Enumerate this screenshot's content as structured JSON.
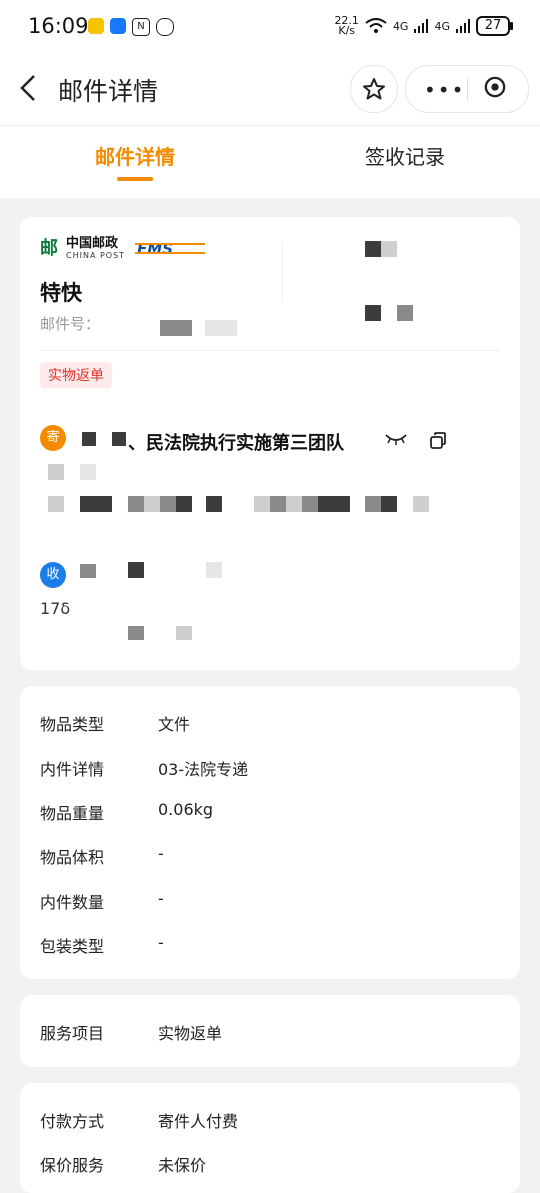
{
  "status_bar": {
    "time": "16:09",
    "net_speed": "22.1\nK/s",
    "signal1": "4G",
    "signal2": "4G",
    "battery": "27"
  },
  "header": {
    "title": "邮件详情",
    "back_icon": "chevron-left-icon",
    "star_icon": "star-icon",
    "more_icon": "more-dots-icon",
    "target_icon": "target-icon"
  },
  "tabs": [
    {
      "label": "邮件详情",
      "active": true
    },
    {
      "label": "签收记录",
      "active": false
    }
  ],
  "mail": {
    "carrier_cn": "中国邮政",
    "carrier_en": "CHINA POST",
    "ems_text": "EMS",
    "service_type": "特快",
    "mail_no_label": "邮件号：",
    "badge": "实物返单",
    "sender": {
      "avatar_text": "寄",
      "name_visible": "、民法院执行实施第三团队"
    },
    "receiver": {
      "avatar_text": "收",
      "partial_line": "17δ"
    }
  },
  "item_info": [
    {
      "label": "物品类型",
      "value": "文件"
    },
    {
      "label": "内件详情",
      "value": "03-法院专递"
    },
    {
      "label": "物品重量",
      "value": "0.06kg"
    },
    {
      "label": "物品体积",
      "value": "-"
    },
    {
      "label": "内件数量",
      "value": "-"
    },
    {
      "label": "包装类型",
      "value": "-"
    }
  ],
  "service": {
    "label": "服务项目",
    "value": "实物返单"
  },
  "payment": [
    {
      "label": "付款方式",
      "value": "寄件人付费"
    },
    {
      "label": "保价服务",
      "value": "未保价"
    }
  ],
  "colors": {
    "accent": "#f28b00",
    "badge_red": "#e0352b",
    "receiver_blue": "#1a7de8"
  }
}
